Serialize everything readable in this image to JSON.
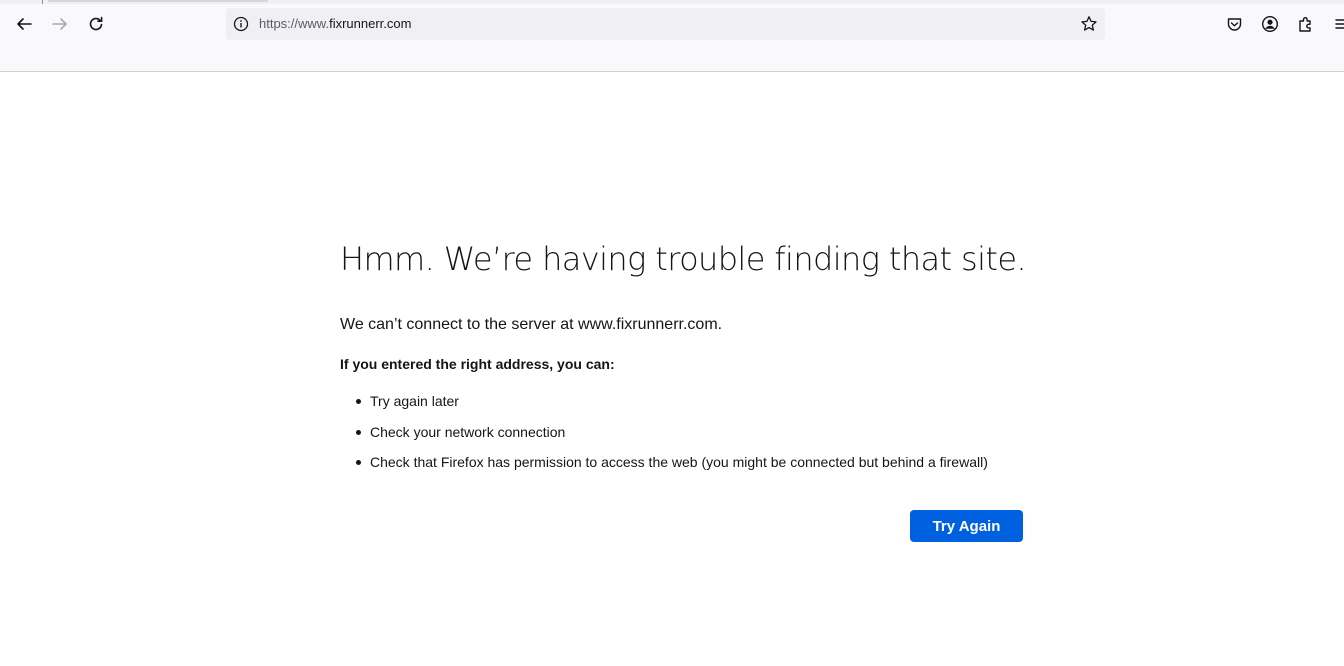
{
  "toolbar": {
    "back_icon": "arrow-left-icon",
    "forward_icon": "arrow-right-icon",
    "reload_icon": "reload-icon",
    "url_scheme": "https://www.",
    "url_host": "fixrunnerr.com",
    "site_info_icon": "info-icon",
    "bookmark_icon": "star-icon",
    "right_icons": [
      "pocket-icon",
      "account-icon",
      "extensions-icon",
      "menu-icon"
    ]
  },
  "error_page": {
    "title": "Hmm. We’re having trouble finding that site.",
    "description": "We can’t connect to the server at www.fixrunnerr.com.",
    "subheading": "If you entered the right address, you can:",
    "suggestions": [
      "Try again later",
      "Check your network connection",
      "Check that Firefox has permission to access the web (you might be connected but behind a firewall)"
    ],
    "button_label": "Try Again"
  },
  "colors": {
    "accent": "#0061e0",
    "toolbar_bg": "#f9f9fb",
    "urlbar_bg": "#f0f0f4",
    "text": "#15141a"
  }
}
